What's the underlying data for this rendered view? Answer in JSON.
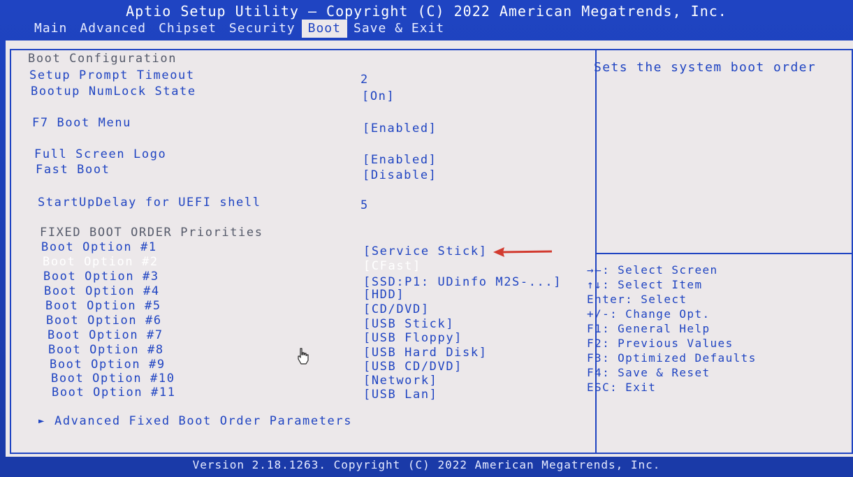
{
  "header": {
    "title": "Aptio Setup Utility – Copyright (C) 2022 American Megatrends, Inc."
  },
  "menu": {
    "items": [
      "Main",
      "Advanced",
      "Chipset",
      "Security",
      "Boot",
      "Save & Exit"
    ],
    "active": "Boot"
  },
  "boot": {
    "section_title": "Boot Configuration",
    "setup_prompt_timeout": {
      "label": "Setup Prompt Timeout",
      "value": "2"
    },
    "bootup_numlock_state": {
      "label": "Bootup NumLock State",
      "value": "[On]"
    },
    "f7_boot_menu": {
      "label": "F7 Boot Menu",
      "value": "[Enabled]"
    },
    "full_screen_logo": {
      "label": "Full Screen Logo",
      "value": "[Enabled]"
    },
    "fast_boot": {
      "label": "Fast Boot",
      "value": "[Disable]"
    },
    "startup_delay": {
      "label": "StartUpDelay for UEFI shell",
      "value": "5"
    },
    "priorities_title": "FIXED BOOT ORDER Priorities",
    "options": [
      {
        "label": "Boot Option #1",
        "value": "[Service Stick]"
      },
      {
        "label": "Boot Option #2",
        "value": "[CFast]"
      },
      {
        "label": "Boot Option #3",
        "value": "[SSD:P1: UDinfo M2S-...]"
      },
      {
        "label": "Boot Option #4",
        "value": "[HDD]"
      },
      {
        "label": "Boot Option #5",
        "value": "[CD/DVD]"
      },
      {
        "label": "Boot Option #6",
        "value": "[USB Stick]"
      },
      {
        "label": "Boot Option #7",
        "value": "[USB Floppy]"
      },
      {
        "label": "Boot Option #8",
        "value": "[USB Hard Disk]"
      },
      {
        "label": "Boot Option #9",
        "value": "[USB CD/DVD]"
      },
      {
        "label": "Boot Option #10",
        "value": "[Network]"
      },
      {
        "label": "Boot Option #11",
        "value": "[USB Lan]"
      }
    ],
    "selected_option_index": 1,
    "advanced_submenu": "Advanced Fixed Boot Order Parameters"
  },
  "help": {
    "text": "Sets the system boot order"
  },
  "keys": [
    "→←: Select Screen",
    "↑↓: Select Item",
    "Enter: Select",
    "+/-: Change Opt.",
    "F1: General Help",
    "F2: Previous Values",
    "F3: Optimized Defaults",
    "F4: Save & Reset",
    "ESC: Exit"
  ],
  "footer": {
    "text": "Version 2.18.1263. Copyright (C) 2022 American Megatrends, Inc."
  },
  "icons": {
    "annotation_arrow": "red-arrow-icon",
    "mouse_cursor": "hand-cursor-icon",
    "submenu": "triangle-right-icon"
  },
  "colors": {
    "bios_blue": "#1f44c2",
    "panel_bg": "#ece8ea",
    "annotation_red": "#d23a2f"
  }
}
